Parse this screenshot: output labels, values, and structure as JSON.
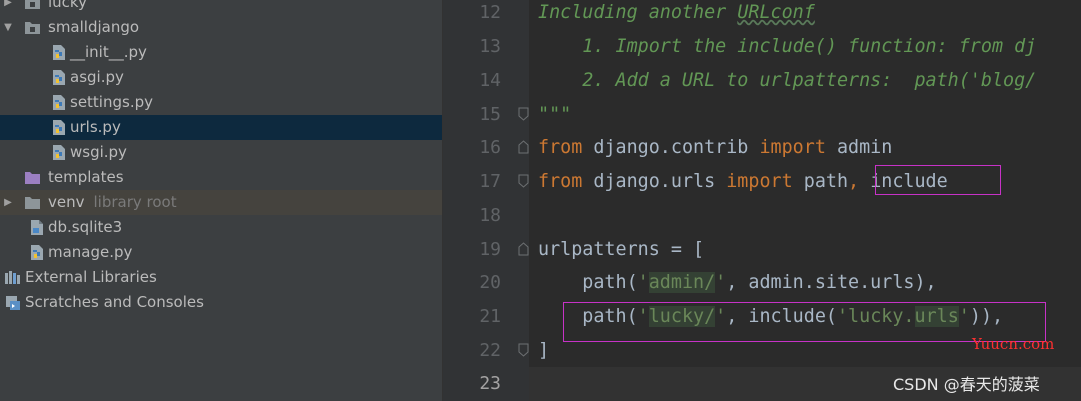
{
  "project_tree": {
    "items": [
      {
        "label": "lucky",
        "icon": "folder-icon",
        "expanded": false
      },
      {
        "label": "smalldjango",
        "icon": "folder-icon",
        "expanded": true
      },
      {
        "label": "__init__.py",
        "icon": "python-file-icon"
      },
      {
        "label": "asgi.py",
        "icon": "python-file-icon"
      },
      {
        "label": "settings.py",
        "icon": "python-file-icon"
      },
      {
        "label": "urls.py",
        "icon": "python-file-icon",
        "selected": true
      },
      {
        "label": "wsgi.py",
        "icon": "python-file-icon"
      },
      {
        "label": "templates",
        "icon": "template-folder-icon"
      },
      {
        "label": "venv",
        "sublabel": "library root",
        "icon": "folder-icon",
        "expanded": false
      },
      {
        "label": "db.sqlite3",
        "icon": "database-file-icon"
      },
      {
        "label": "manage.py",
        "icon": "python-file-icon"
      },
      {
        "label": "External Libraries",
        "icon": "libraries-icon"
      },
      {
        "label": "Scratches and Consoles",
        "icon": "scratches-icon"
      }
    ]
  },
  "editor": {
    "line_numbers": [
      "12",
      "13",
      "14",
      "15",
      "16",
      "17",
      "18",
      "19",
      "20",
      "21",
      "22",
      "23"
    ],
    "current_line": "23",
    "lines": {
      "l12": "Including another URLconf",
      "l13": "    1. Import the include() function: from dj",
      "l14": "    2. Add a URL to urlpatterns:  path('blog/",
      "l15": "\"\"\"",
      "l16": {
        "kw1": "from",
        "mod": " django.contrib ",
        "kw2": "import",
        "name": " admin"
      },
      "l17": {
        "kw1": "from",
        "mod": " django.urls ",
        "kw2": "import",
        "name": " path",
        "rest": ", include"
      },
      "l19": "urlpatterns = [",
      "l20": {
        "p1": "    path(",
        "s1": "'",
        "s2": "admin/",
        "s3": "'",
        "p2": ", admin.site.urls),"
      },
      "l21": {
        "p1": "    path(",
        "s1": "'",
        "s2": "lucky/",
        "s3": "'",
        "p2": ", include(",
        "s4": "'lucky.",
        "s5": "urls",
        "s6": "'",
        "p3": ")),"
      },
      "l22": "]"
    }
  },
  "watermarks": {
    "site": "Yuucn.com",
    "credit": "CSDN @春天的菠菜"
  },
  "colors": {
    "keyword": "#cc7832",
    "string": "#6a8759",
    "docstring": "#629755",
    "highlight_box": "#c732c7",
    "selection": "#0d293e"
  }
}
